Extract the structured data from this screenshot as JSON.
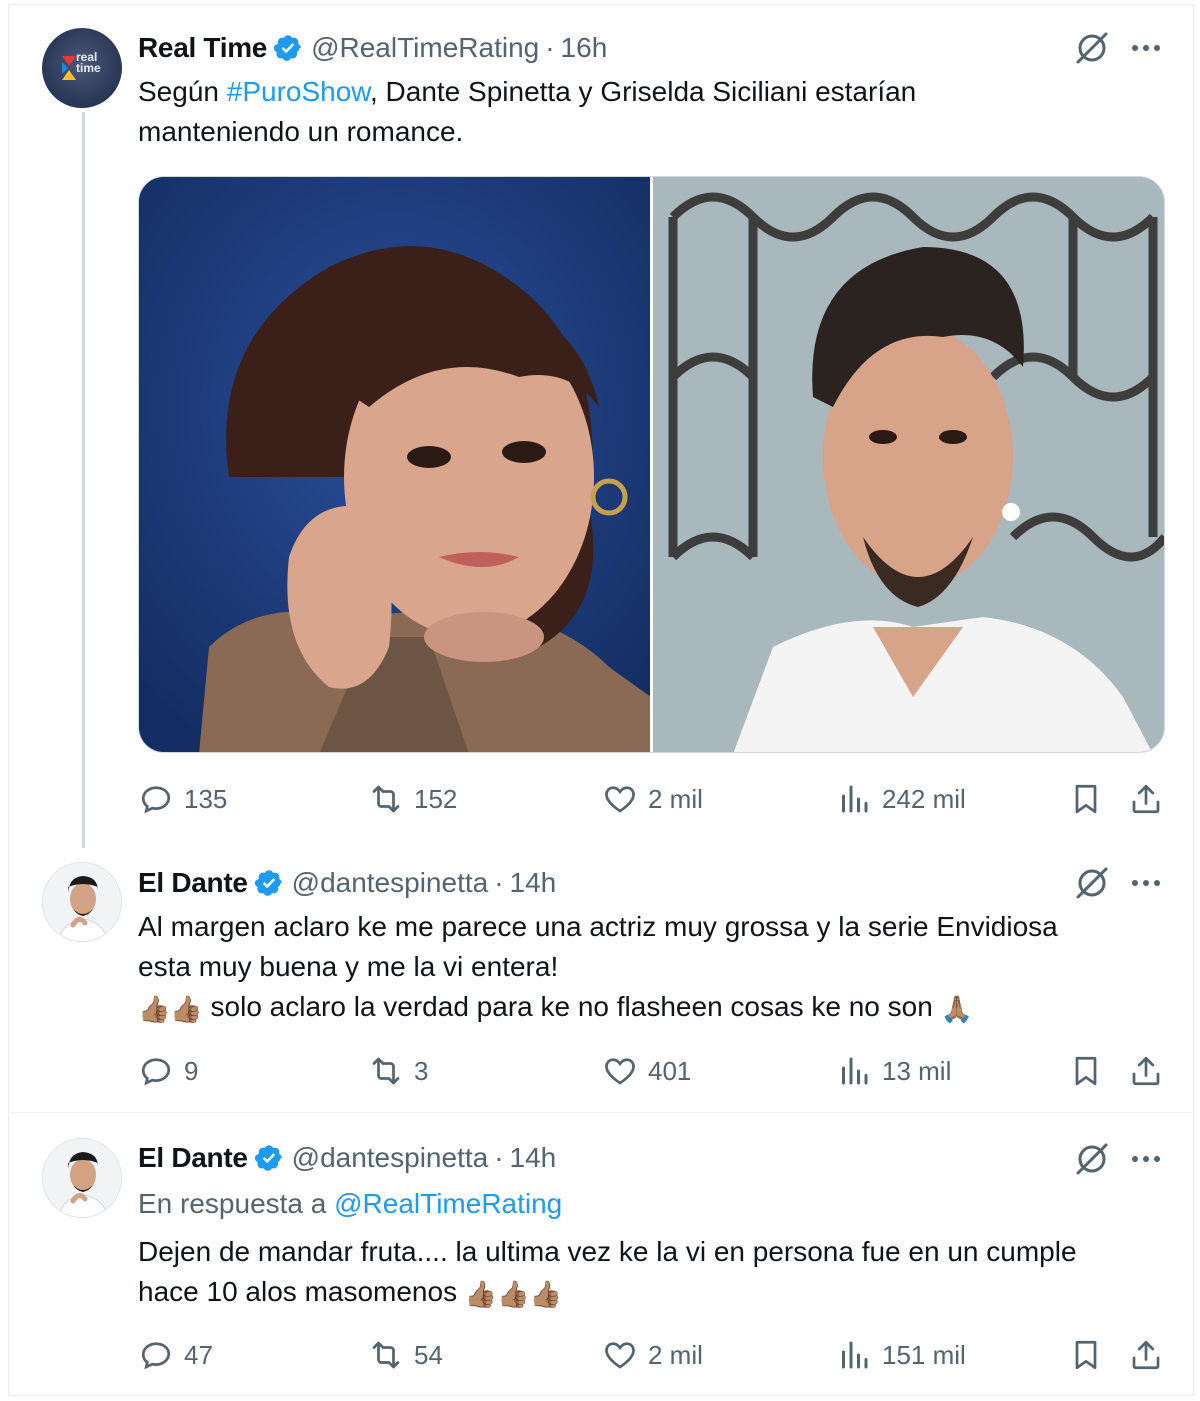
{
  "tweets": [
    {
      "author": {
        "name": "Real Time",
        "handle": "@RealTimeRating",
        "time": "16h",
        "avatar_text": "real time"
      },
      "text": {
        "prefix": "Según ",
        "hashtag": "#PuroShow",
        "line1_rest": ", Dante Spinetta y Griselda Siciliani estarían",
        "line2": "manteniendo un romance."
      },
      "stats": {
        "replies": "135",
        "retweets": "152",
        "likes": "2 mil",
        "views": "242 mil"
      }
    },
    {
      "author": {
        "name": "El Dante",
        "handle": "@dantespinetta",
        "time": "14h"
      },
      "text": {
        "line1": "Al margen aclaro ke me parece una actriz muy grossa y la serie Envidiosa",
        "line2": "esta muy buena y me la vi entera!",
        "line3": "solo aclaro la verdad para ke no flasheen cosas ke no son"
      },
      "stats": {
        "replies": "9",
        "retweets": "3",
        "likes": "401",
        "views": "13 mil"
      }
    },
    {
      "author": {
        "name": "El Dante",
        "handle": "@dantespinetta",
        "time": "14h"
      },
      "reply_to": {
        "prefix": "En respuesta a ",
        "mention": "@RealTimeRating"
      },
      "text": {
        "line1": "Dejen de mandar fruta.... la ultima vez ke la vi en persona fue en un cumple",
        "line2": "hace 10 alos masomenos"
      },
      "stats": {
        "replies": "47",
        "retweets": "54",
        "likes": "2 mil",
        "views": "151 mil"
      }
    }
  ],
  "ui": {
    "dot": "·",
    "more": "···"
  },
  "colors": {
    "accent": "#1d9bf0",
    "secondary_text": "#536471",
    "verified": "#1d9bf0"
  },
  "icons": [
    "verified-badge-icon",
    "grok-icon",
    "more-icon",
    "reply-icon",
    "retweet-icon",
    "like-icon",
    "views-icon",
    "bookmark-icon",
    "share-icon",
    "thumbs-up-icon",
    "folded-hands-icon"
  ]
}
